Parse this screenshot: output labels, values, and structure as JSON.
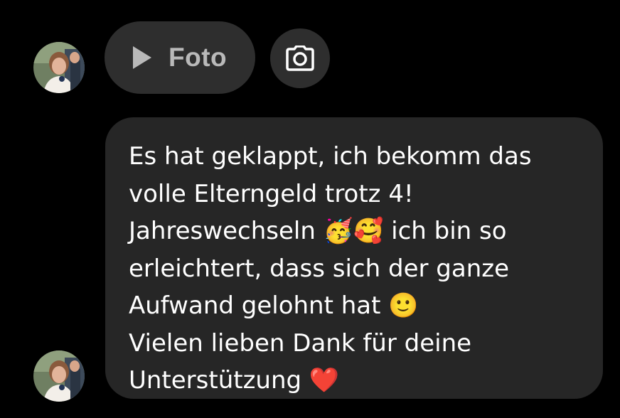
{
  "conversation": {
    "attachment": {
      "play_icon": "play-icon",
      "label": "Foto"
    },
    "camera_button": {
      "icon": "camera-icon"
    },
    "message": {
      "text": "Es hat geklappt, ich bekomm das\nvolle Elterngeld trotz 4!\nJahreswechseln 🥳🥰 ich bin so\nerleichtert, dass sich der ganze\nAufwand gelohnt hat 🙂\nVielen lieben Dank für deine\nUnterstützung ❤️"
    }
  },
  "colors": {
    "background": "#000000",
    "bubble": "#262626",
    "pill": "#2e2e2e",
    "muted_text": "#b9b9b9",
    "text": "#ffffff"
  }
}
